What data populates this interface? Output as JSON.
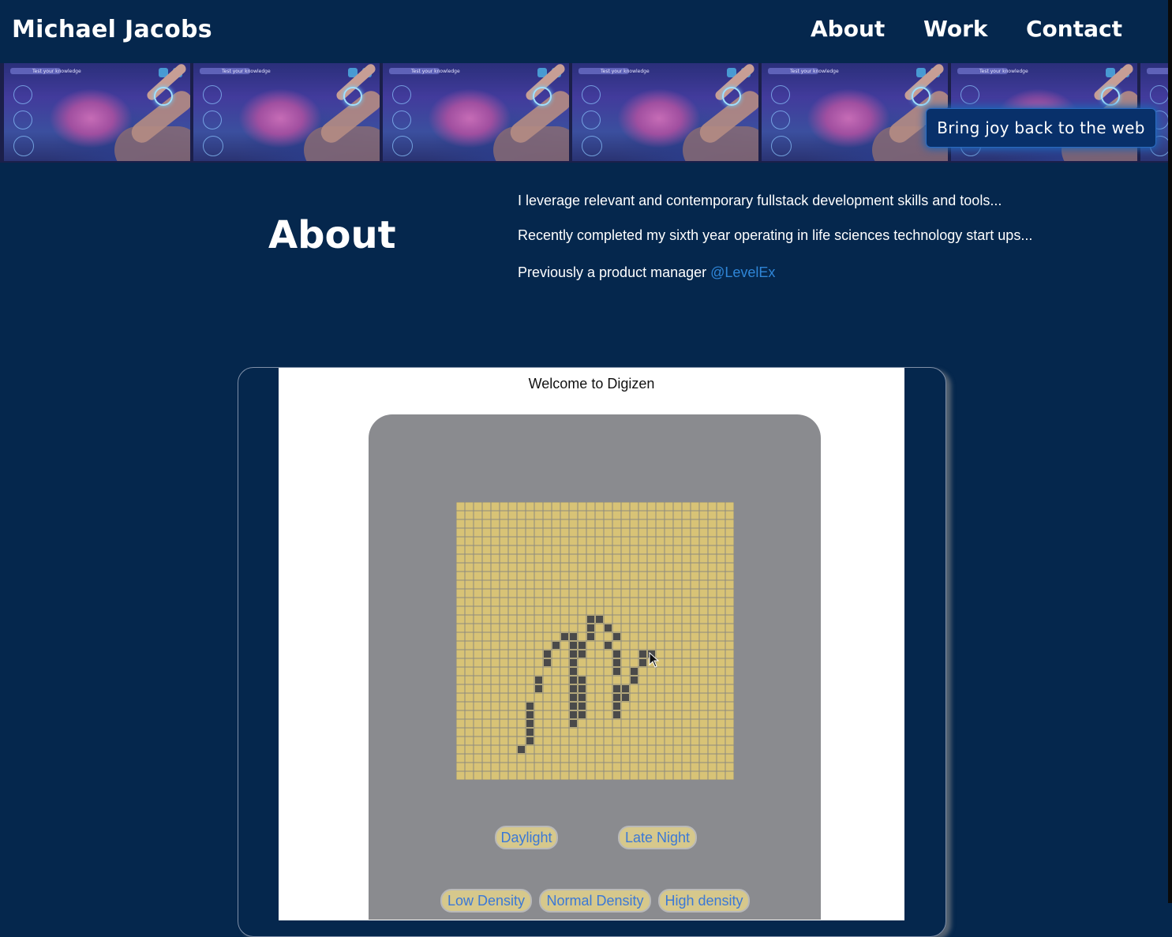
{
  "header": {
    "brand": "Michael Jacobs",
    "nav": [
      {
        "label": "About"
      },
      {
        "label": "Work"
      },
      {
        "label": "Contact"
      }
    ]
  },
  "banner": {
    "tile_caption": "Test your knowledge",
    "cta_label": "Bring joy back to the web"
  },
  "about": {
    "title": "About",
    "line1": "I leverage relevant and contemporary fullstack development skills and tools...",
    "line2": "Recently completed my sixth year operating in life sciences technology start ups...",
    "line3_prefix": "Previously a product manager ",
    "line3_link": "@LevelEx"
  },
  "app": {
    "welcome": "Welcome to Digizen",
    "buttons_row1": [
      "Daylight",
      "Late Night"
    ],
    "buttons_row2": [
      "Low Density",
      "Normal Density",
      "High density"
    ],
    "grid": {
      "cols": 32,
      "rows": 32,
      "cell_color": "#d8c376",
      "line_color": "#8e8b7f",
      "active_color": "#4a4a4a",
      "active_cells": [
        [
          15,
          13
        ],
        [
          16,
          13
        ],
        [
          15,
          14
        ],
        [
          17,
          14
        ],
        [
          12,
          15
        ],
        [
          13,
          15
        ],
        [
          15,
          15
        ],
        [
          18,
          15
        ],
        [
          11,
          16
        ],
        [
          13,
          16
        ],
        [
          14,
          16
        ],
        [
          17,
          16
        ],
        [
          10,
          17
        ],
        [
          13,
          17
        ],
        [
          14,
          17
        ],
        [
          18,
          17
        ],
        [
          21,
          17
        ],
        [
          22,
          17
        ],
        [
          10,
          18
        ],
        [
          13,
          18
        ],
        [
          18,
          18
        ],
        [
          21,
          18
        ],
        [
          13,
          19
        ],
        [
          18,
          19
        ],
        [
          20,
          19
        ],
        [
          9,
          20
        ],
        [
          13,
          20
        ],
        [
          14,
          20
        ],
        [
          20,
          20
        ],
        [
          9,
          21
        ],
        [
          13,
          21
        ],
        [
          14,
          21
        ],
        [
          18,
          21
        ],
        [
          19,
          21
        ],
        [
          13,
          22
        ],
        [
          14,
          22
        ],
        [
          18,
          22
        ],
        [
          19,
          22
        ],
        [
          8,
          23
        ],
        [
          13,
          23
        ],
        [
          14,
          23
        ],
        [
          18,
          23
        ],
        [
          8,
          24
        ],
        [
          13,
          24
        ],
        [
          14,
          24
        ],
        [
          18,
          24
        ],
        [
          8,
          25
        ],
        [
          13,
          25
        ],
        [
          8,
          26
        ],
        [
          8,
          27
        ],
        [
          7,
          28
        ]
      ]
    }
  },
  "colors": {
    "page_bg": "#05274d",
    "link": "#2f86d8",
    "cta_glow": "#1e64b6"
  }
}
